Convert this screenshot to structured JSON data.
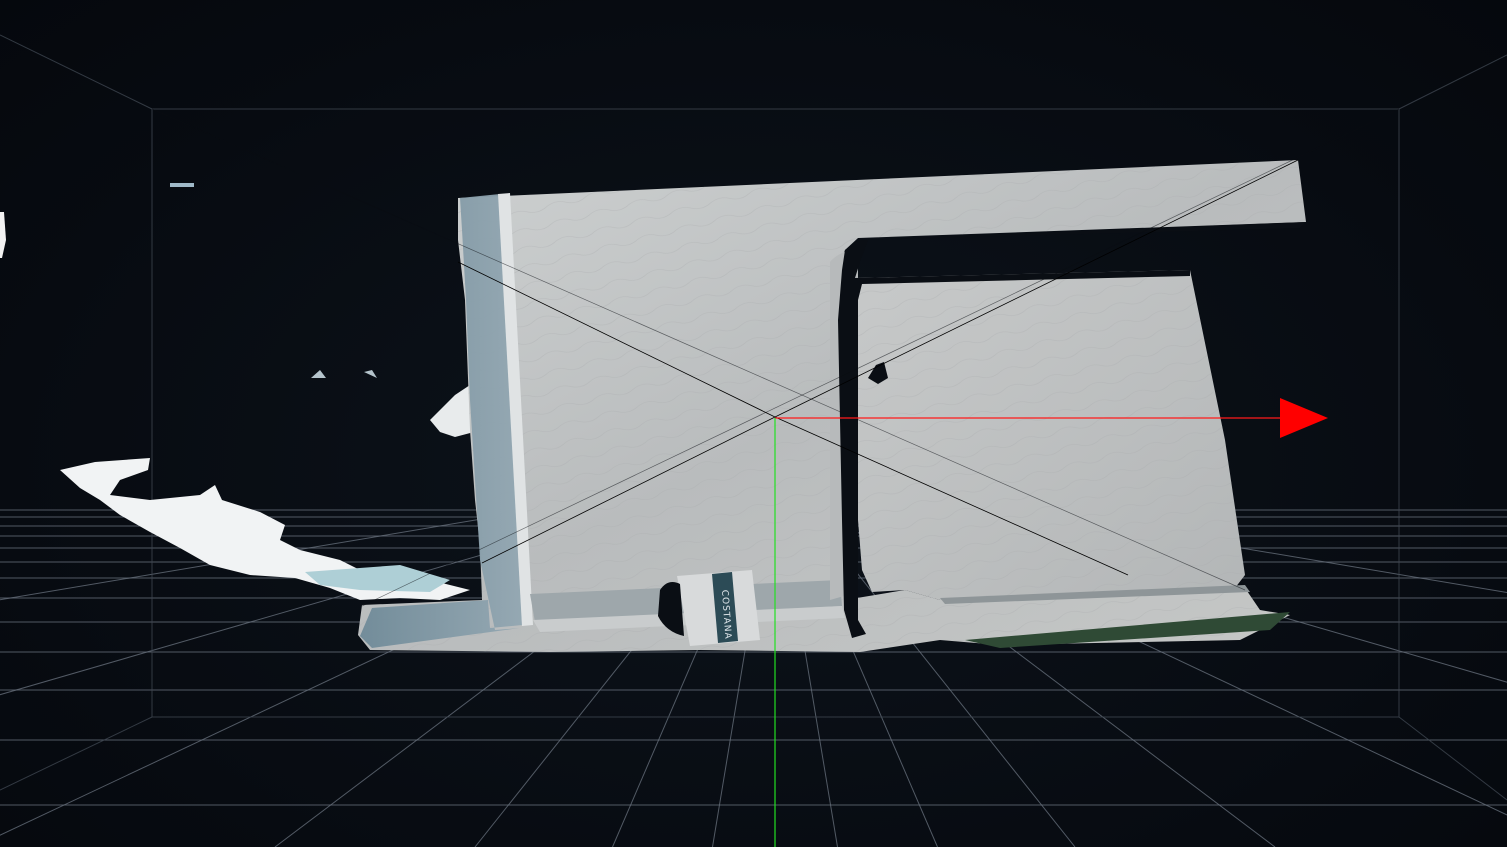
{
  "viewer": {
    "background": "#070b11",
    "grid_color": "#6b7480",
    "axes": {
      "x_axis": {
        "color": "#ff0000",
        "direction": "right"
      },
      "y_axis": {
        "color": "#00dd00",
        "direction": "down"
      }
    }
  },
  "scene": {
    "box_label": "COSTANA"
  }
}
